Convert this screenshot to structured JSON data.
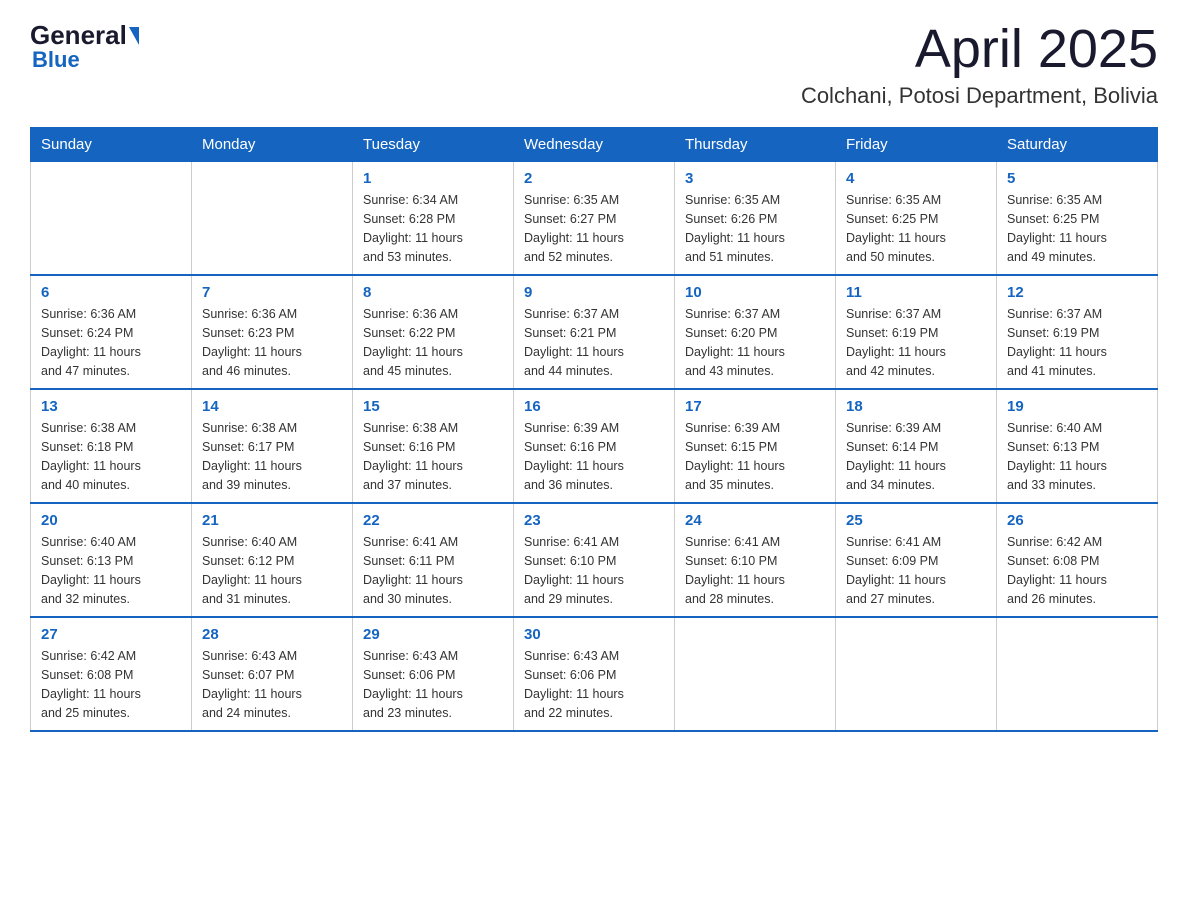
{
  "logo": {
    "general": "General",
    "blue": "Blue"
  },
  "title": "April 2025",
  "subtitle": "Colchani, Potosi Department, Bolivia",
  "weekdays": [
    "Sunday",
    "Monday",
    "Tuesday",
    "Wednesday",
    "Thursday",
    "Friday",
    "Saturday"
  ],
  "weeks": [
    [
      {
        "day": "",
        "info": ""
      },
      {
        "day": "",
        "info": ""
      },
      {
        "day": "1",
        "info": "Sunrise: 6:34 AM\nSunset: 6:28 PM\nDaylight: 11 hours\nand 53 minutes."
      },
      {
        "day": "2",
        "info": "Sunrise: 6:35 AM\nSunset: 6:27 PM\nDaylight: 11 hours\nand 52 minutes."
      },
      {
        "day": "3",
        "info": "Sunrise: 6:35 AM\nSunset: 6:26 PM\nDaylight: 11 hours\nand 51 minutes."
      },
      {
        "day": "4",
        "info": "Sunrise: 6:35 AM\nSunset: 6:25 PM\nDaylight: 11 hours\nand 50 minutes."
      },
      {
        "day": "5",
        "info": "Sunrise: 6:35 AM\nSunset: 6:25 PM\nDaylight: 11 hours\nand 49 minutes."
      }
    ],
    [
      {
        "day": "6",
        "info": "Sunrise: 6:36 AM\nSunset: 6:24 PM\nDaylight: 11 hours\nand 47 minutes."
      },
      {
        "day": "7",
        "info": "Sunrise: 6:36 AM\nSunset: 6:23 PM\nDaylight: 11 hours\nand 46 minutes."
      },
      {
        "day": "8",
        "info": "Sunrise: 6:36 AM\nSunset: 6:22 PM\nDaylight: 11 hours\nand 45 minutes."
      },
      {
        "day": "9",
        "info": "Sunrise: 6:37 AM\nSunset: 6:21 PM\nDaylight: 11 hours\nand 44 minutes."
      },
      {
        "day": "10",
        "info": "Sunrise: 6:37 AM\nSunset: 6:20 PM\nDaylight: 11 hours\nand 43 minutes."
      },
      {
        "day": "11",
        "info": "Sunrise: 6:37 AM\nSunset: 6:19 PM\nDaylight: 11 hours\nand 42 minutes."
      },
      {
        "day": "12",
        "info": "Sunrise: 6:37 AM\nSunset: 6:19 PM\nDaylight: 11 hours\nand 41 minutes."
      }
    ],
    [
      {
        "day": "13",
        "info": "Sunrise: 6:38 AM\nSunset: 6:18 PM\nDaylight: 11 hours\nand 40 minutes."
      },
      {
        "day": "14",
        "info": "Sunrise: 6:38 AM\nSunset: 6:17 PM\nDaylight: 11 hours\nand 39 minutes."
      },
      {
        "day": "15",
        "info": "Sunrise: 6:38 AM\nSunset: 6:16 PM\nDaylight: 11 hours\nand 37 minutes."
      },
      {
        "day": "16",
        "info": "Sunrise: 6:39 AM\nSunset: 6:16 PM\nDaylight: 11 hours\nand 36 minutes."
      },
      {
        "day": "17",
        "info": "Sunrise: 6:39 AM\nSunset: 6:15 PM\nDaylight: 11 hours\nand 35 minutes."
      },
      {
        "day": "18",
        "info": "Sunrise: 6:39 AM\nSunset: 6:14 PM\nDaylight: 11 hours\nand 34 minutes."
      },
      {
        "day": "19",
        "info": "Sunrise: 6:40 AM\nSunset: 6:13 PM\nDaylight: 11 hours\nand 33 minutes."
      }
    ],
    [
      {
        "day": "20",
        "info": "Sunrise: 6:40 AM\nSunset: 6:13 PM\nDaylight: 11 hours\nand 32 minutes."
      },
      {
        "day": "21",
        "info": "Sunrise: 6:40 AM\nSunset: 6:12 PM\nDaylight: 11 hours\nand 31 minutes."
      },
      {
        "day": "22",
        "info": "Sunrise: 6:41 AM\nSunset: 6:11 PM\nDaylight: 11 hours\nand 30 minutes."
      },
      {
        "day": "23",
        "info": "Sunrise: 6:41 AM\nSunset: 6:10 PM\nDaylight: 11 hours\nand 29 minutes."
      },
      {
        "day": "24",
        "info": "Sunrise: 6:41 AM\nSunset: 6:10 PM\nDaylight: 11 hours\nand 28 minutes."
      },
      {
        "day": "25",
        "info": "Sunrise: 6:41 AM\nSunset: 6:09 PM\nDaylight: 11 hours\nand 27 minutes."
      },
      {
        "day": "26",
        "info": "Sunrise: 6:42 AM\nSunset: 6:08 PM\nDaylight: 11 hours\nand 26 minutes."
      }
    ],
    [
      {
        "day": "27",
        "info": "Sunrise: 6:42 AM\nSunset: 6:08 PM\nDaylight: 11 hours\nand 25 minutes."
      },
      {
        "day": "28",
        "info": "Sunrise: 6:43 AM\nSunset: 6:07 PM\nDaylight: 11 hours\nand 24 minutes."
      },
      {
        "day": "29",
        "info": "Sunrise: 6:43 AM\nSunset: 6:06 PM\nDaylight: 11 hours\nand 23 minutes."
      },
      {
        "day": "30",
        "info": "Sunrise: 6:43 AM\nSunset: 6:06 PM\nDaylight: 11 hours\nand 22 minutes."
      },
      {
        "day": "",
        "info": ""
      },
      {
        "day": "",
        "info": ""
      },
      {
        "day": "",
        "info": ""
      }
    ]
  ]
}
